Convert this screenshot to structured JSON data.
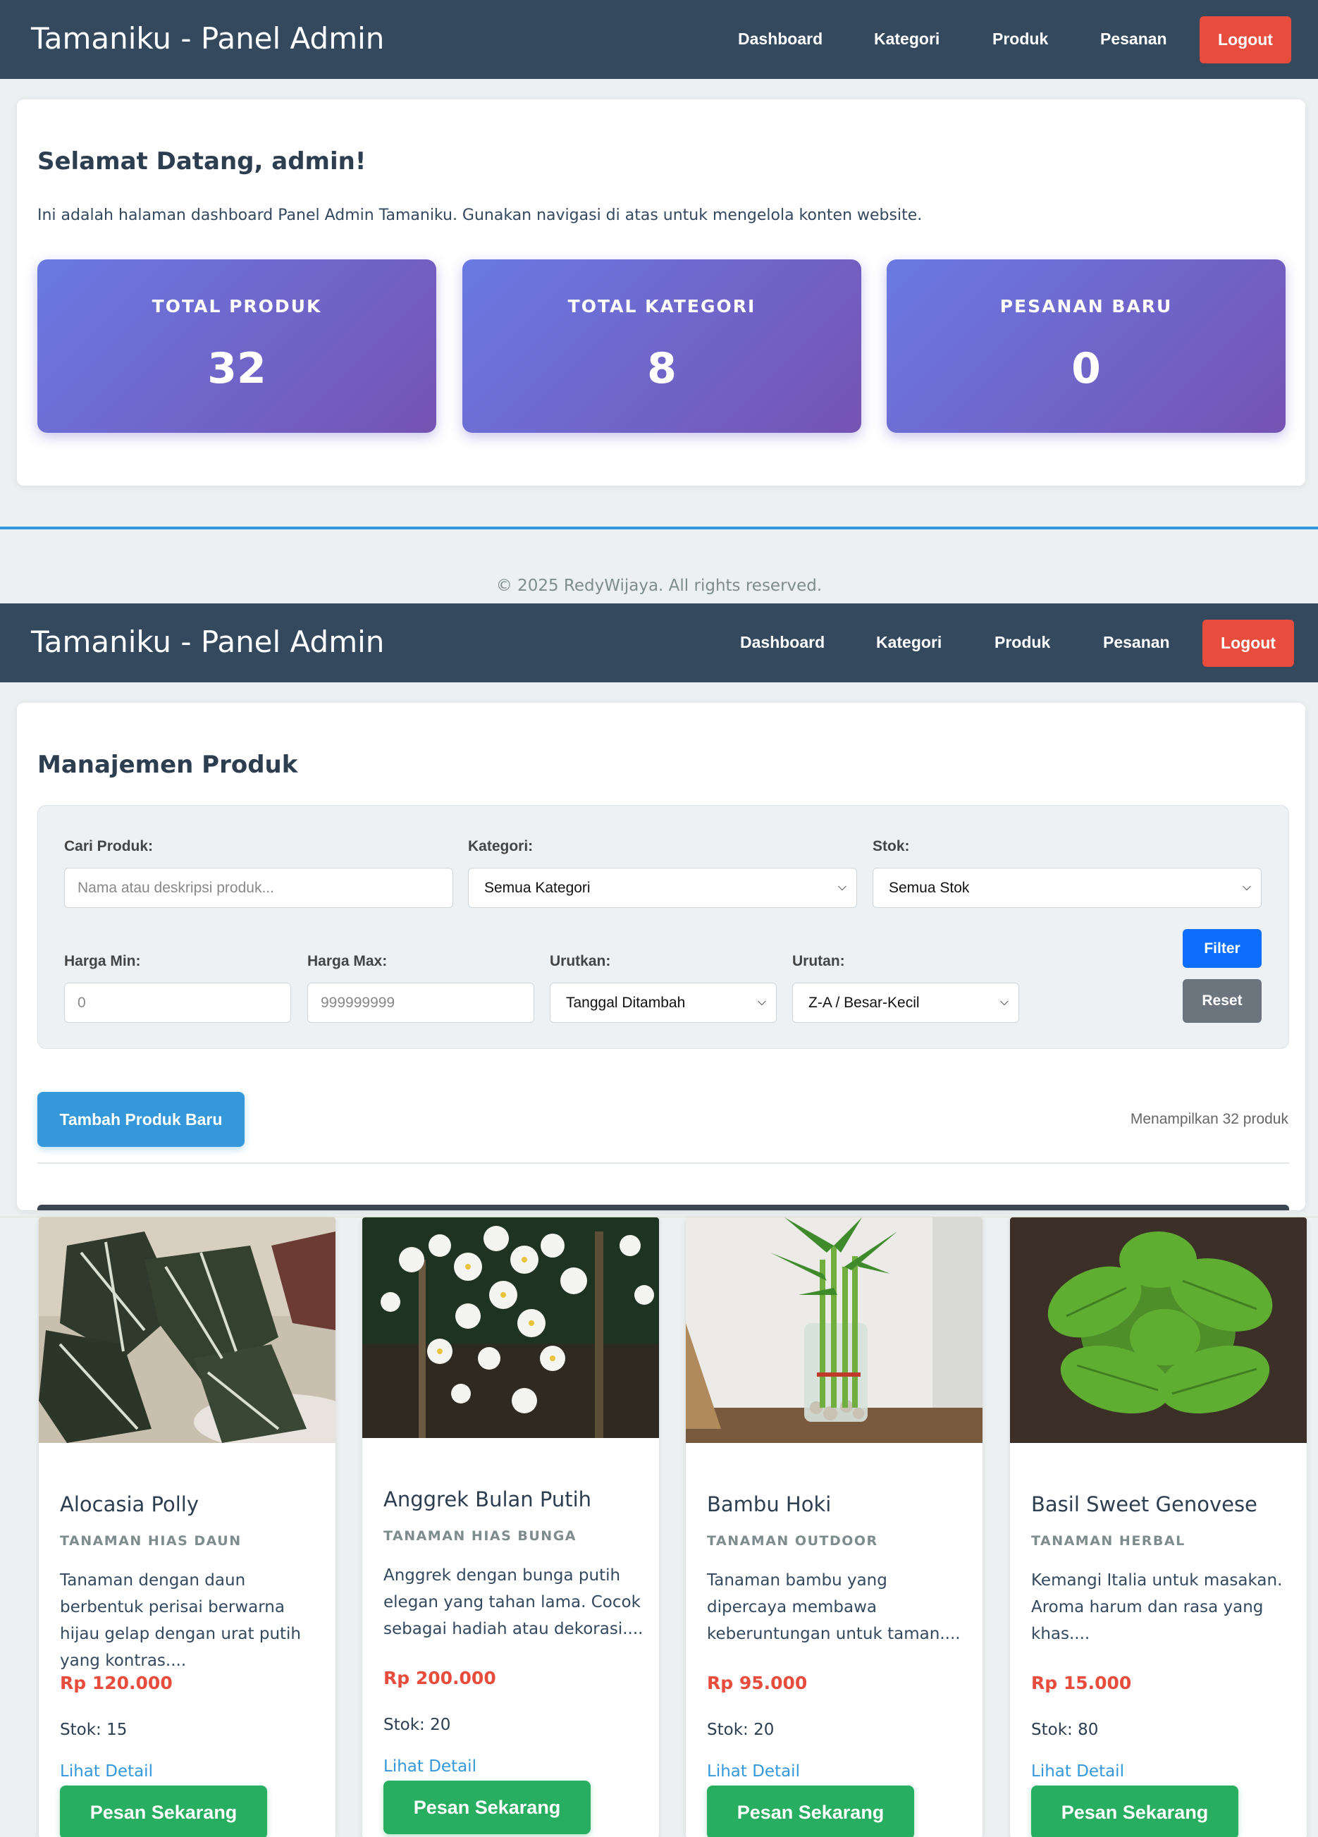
{
  "navbar": {
    "brand": "Tamaniku - Panel Admin",
    "links": [
      "Dashboard",
      "Kategori",
      "Produk",
      "Pesanan"
    ],
    "logout": "Logout"
  },
  "dashboard": {
    "title": "Selamat Datang, admin!",
    "intro": "Ini adalah halaman dashboard Panel Admin Tamaniku. Gunakan navigasi di atas untuk mengelola konten website.",
    "stats": [
      {
        "label": "Total Produk",
        "value": "32"
      },
      {
        "label": "Total Kategori",
        "value": "8"
      },
      {
        "label": "Pesanan Baru",
        "value": "0"
      }
    ]
  },
  "footer": {
    "text": "© 2025 RedyWijaya. All rights reserved."
  },
  "products_page": {
    "title": "Manajemen Produk",
    "filters": {
      "search_label": "Cari Produk:",
      "search_placeholder": "Nama atau deskripsi produk...",
      "category_label": "Kategori:",
      "category_value": "Semua Kategori",
      "stock_label": "Stok:",
      "stock_value": "Semua Stok",
      "min_label": "Harga Min:",
      "min_placeholder": "0",
      "max_label": "Harga Max:",
      "max_placeholder": "999999999",
      "sort_label": "Urutkan:",
      "sort_value": "Tanggal Ditambah",
      "order_label": "Urutan:",
      "order_value": "Z-A / Besar-Kecil",
      "filter_button": "Filter",
      "reset_button": "Reset"
    },
    "add_button": "Tambah Produk Baru",
    "count_text": "Menampilkan 32 produk",
    "products": [
      {
        "name": "Alocasia Polly",
        "category": "Tanaman Hias Daun",
        "description": "Tanaman dengan daun berbentuk perisai berwarna hijau gelap dengan urat putih yang kontras....",
        "price": "Rp 120.000",
        "stock": "Stok: 15",
        "detail": "Lihat Detail",
        "order": "Pesan Sekarang",
        "image": "alocasia-leaves"
      },
      {
        "name": "Anggrek Bulan Putih",
        "category": "Tanaman Hias Bunga",
        "description": "Anggrek dengan bunga putih elegan yang tahan lama. Cocok sebagai hadiah atau dekorasi....",
        "price": "Rp 200.000",
        "stock": "Stok: 20",
        "detail": "Lihat Detail",
        "order": "Pesan Sekarang",
        "image": "white-orchids"
      },
      {
        "name": "Bambu Hoki",
        "category": "Tanaman Outdoor",
        "description": "Tanaman bambu yang dipercaya membawa keberuntungan untuk taman....",
        "price": "Rp 95.000",
        "stock": "Stok: 20",
        "detail": "Lihat Detail",
        "order": "Pesan Sekarang",
        "image": "lucky-bamboo"
      },
      {
        "name": "Basil Sweet Genovese",
        "category": "Tanaman Herbal",
        "description": "Kemangi Italia untuk masakan. Aroma harum dan rasa yang khas....",
        "price": "Rp 15.000",
        "stock": "Stok: 80",
        "detail": "Lihat Detail",
        "order": "Pesan Sekarang",
        "image": "basil-plant"
      }
    ]
  },
  "colors": {
    "navbar": "#34495e",
    "logout": "#e74c3c",
    "accent": "#3498db",
    "stat_gradient_start": "#6a7ae3",
    "stat_gradient_end": "#7553b3",
    "price": "#e74c3c",
    "order_button": "#27ae60"
  }
}
